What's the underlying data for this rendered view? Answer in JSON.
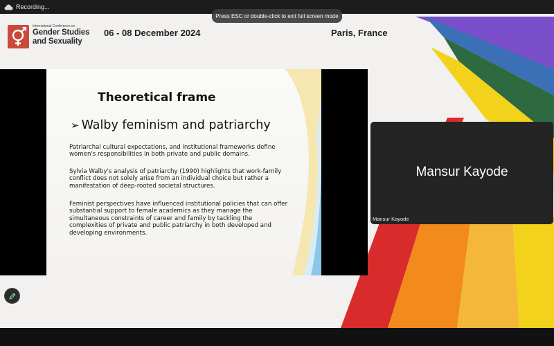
{
  "recording": {
    "label": "Recording..."
  },
  "fullscreen_notice": "Press ESC or double-click to exit full screen mode",
  "conference": {
    "name_small": "International Conference on",
    "name_line1": "Gender Studies",
    "name_line2": "and Sexuality",
    "date": "06 - 08 December 2024",
    "location": "Paris, France"
  },
  "slide": {
    "title": "Theoretical frame",
    "bullet": "Walby feminism and patriarchy",
    "paragraphs": [
      "Patriarchal cultural expectations, and institutional frameworks define women's responsibilities in both private and public domains.",
      "Sylvia Walby's analysis of patriarchy (1990) highlights that work-family conflict does not solely arise from an individual choice but rather a manifestation of deep-rooted societal structures.",
      "Feminist perspectives have influenced institutional policies that can offer substantial support to female academics as they manage the simultaneous constraints of career and family by tackling the complexities of private and public patriarchy in both developed and developing environments."
    ]
  },
  "participant": {
    "display_name": "Mansur Kayode",
    "label": "Mansur Kayode"
  },
  "icons": {
    "recording": "cloud-record-icon",
    "bullet": "arrowhead-bullet-icon",
    "annotate": "pencil-icon"
  },
  "colors": {
    "logo": "#c94a3a",
    "rainbow": [
      "#7b4fc9",
      "#3b6fb6",
      "#2e6a3f",
      "#f3d21b",
      "#f28a1c",
      "#d92b2b"
    ]
  }
}
